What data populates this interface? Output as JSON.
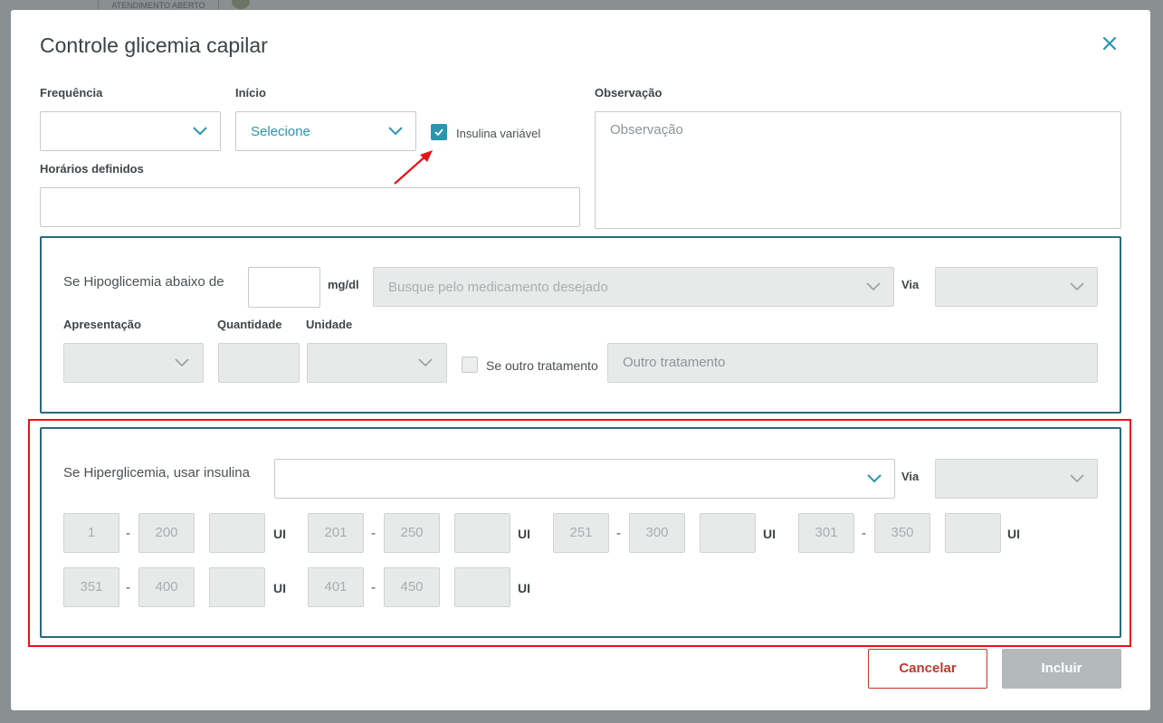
{
  "background": {
    "status_tag": "ATENDIMENTO ABERTO"
  },
  "modal": {
    "title": "Controle glicemia capilar",
    "close_icon": "close-icon"
  },
  "form": {
    "frequencia_label": "Frequência",
    "frequencia_value": "",
    "inicio_label": "Início",
    "inicio_value": "Selecione",
    "insulina_variavel_label": "Insulina variável",
    "insulina_variavel_checked": true,
    "horarios_label": "Horários definidos",
    "horarios_value": "",
    "observacao_label": "Observação",
    "observacao_placeholder": "Observação"
  },
  "hipo": {
    "label": "Se Hipoglicemia abaixo de",
    "unit": "mg/dl",
    "med_placeholder": "Busque pelo medicamento desejado",
    "via_label": "Via",
    "apresentacao_label": "Apresentação",
    "quantidade_label": "Quantidade",
    "unidade_label": "Unidade",
    "outro_tratamento_checkbox_label": "Se outro tratamento",
    "outro_tratamento_placeholder": "Outro tratamento"
  },
  "hiper": {
    "label": "Se Hiperglicemia, usar insulina",
    "via_label": "Via",
    "unit": "UI",
    "dash": "-",
    "ranges": [
      {
        "from": "1",
        "to": "200"
      },
      {
        "from": "201",
        "to": "250"
      },
      {
        "from": "251",
        "to": "300"
      },
      {
        "from": "301",
        "to": "350"
      },
      {
        "from": "351",
        "to": "400"
      },
      {
        "from": "401",
        "to": "450"
      }
    ]
  },
  "actions": {
    "cancel_label": "Cancelar",
    "submit_label": "Incluir"
  },
  "colors": {
    "accent": "#2a95b0",
    "section_border": "#2b6a7c",
    "highlight": "#e5141a",
    "cancel": "#c0392b",
    "submit_disabled": "#b4b9bb"
  }
}
